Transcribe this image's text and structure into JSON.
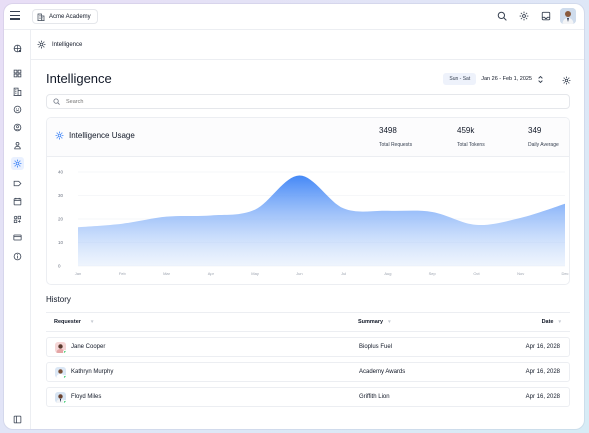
{
  "topbar": {
    "org_name": "Acme Academy",
    "icons": [
      "menu-icon",
      "building-icon",
      "search-icon",
      "gear-icon",
      "inbox-icon",
      "avatar"
    ]
  },
  "sidebar": {
    "items": [
      {
        "name": "globe-icon",
        "active": false
      },
      {
        "name": "dashboard-icon",
        "active": false
      },
      {
        "name": "building-icon",
        "active": false
      },
      {
        "name": "smile-icon",
        "active": false
      },
      {
        "name": "user-circle-icon",
        "active": false
      },
      {
        "name": "user-icon",
        "active": false
      },
      {
        "name": "intelligence-icon",
        "active": true
      },
      {
        "name": "tag-icon",
        "active": false
      },
      {
        "name": "calendar-icon",
        "active": false
      },
      {
        "name": "apps-icon",
        "active": false
      },
      {
        "name": "card-icon",
        "active": false
      },
      {
        "name": "info-icon",
        "active": false
      }
    ],
    "footer_icon": "collapse-sidebar-icon"
  },
  "breadcrumb": {
    "label": "Intelligence"
  },
  "page": {
    "title": "Intelligence",
    "week_badge": "Sun - Sat",
    "date_range": "Jan 26 - Feb 1, 2025"
  },
  "search": {
    "placeholder": "Search",
    "value": ""
  },
  "usage": {
    "title": "Intelligence Usage",
    "metrics": [
      {
        "value": "3498",
        "label": "Total Requests"
      },
      {
        "value": "459k",
        "label": "Total Tokens"
      },
      {
        "value": "349",
        "label": "Daily Average"
      }
    ]
  },
  "chart_data": {
    "type": "area",
    "x": [
      "Jan",
      "Feb",
      "Mar",
      "Apr",
      "May",
      "Jun",
      "Jul",
      "Aug",
      "Sep",
      "Oct",
      "Nov",
      "Dec"
    ],
    "y": [
      16.5,
      18,
      21,
      21.5,
      24,
      38.5,
      24.5,
      23.5,
      23,
      17.5,
      20.5,
      26.5
    ],
    "ylim": [
      0,
      40
    ],
    "yticks": [
      0,
      10,
      20,
      30,
      40
    ],
    "grid": true,
    "color": "#3b82f6"
  },
  "history": {
    "title": "History",
    "columns": [
      "Requester",
      "Summary",
      "Date"
    ],
    "rows": [
      {
        "requester": "Jane Cooper",
        "summary": "Bioplus Fuel",
        "date": "Apr 16, 2028"
      },
      {
        "requester": "Kathryn Murphy",
        "summary": "Academy Awards",
        "date": "Apr 16, 2028"
      },
      {
        "requester": "Floyd Miles",
        "summary": "Griffith Lion",
        "date": "Apr 16, 2028"
      }
    ]
  },
  "colors": {
    "accent": "#3b82f6",
    "online": "#22c55e",
    "badge_bg": "#eef2fb"
  }
}
